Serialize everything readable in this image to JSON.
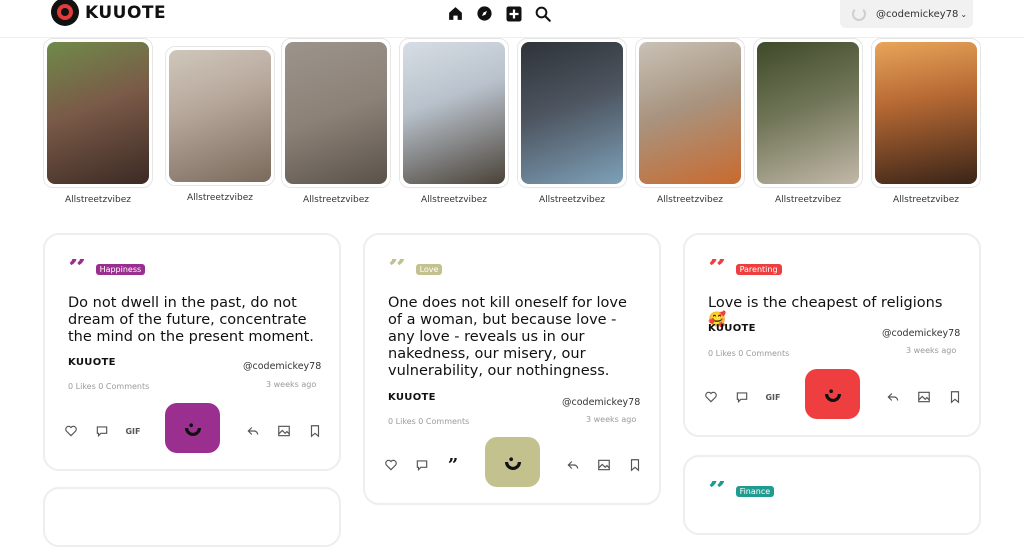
{
  "brand": {
    "name": "KUUOTE"
  },
  "header": {
    "nav": [
      "home-icon",
      "compass-icon",
      "add-icon",
      "search-icon"
    ],
    "user": {
      "handle": "@codemickey78"
    }
  },
  "stories": [
    {
      "author": "Allstreetzvibez",
      "color": "#7a5a48"
    },
    {
      "author": "Allstreetzvibez",
      "color": "#b8a89c"
    },
    {
      "author": "Allstreetzvibez",
      "color": "#8c8177"
    },
    {
      "author": "Allstreetzvibez",
      "color": "#b9c2cc"
    },
    {
      "author": "Allstreetzvibez",
      "color": "#4d5560"
    },
    {
      "author": "Allstreetzvibez",
      "color": "#a89480"
    },
    {
      "author": "Allstreetzvibez",
      "color": "#6f7456"
    },
    {
      "author": "Allstreetzvibez",
      "color": "#8a5a3a"
    }
  ],
  "cards": [
    {
      "tag": "Happiness",
      "color": "#9b2f8f",
      "quote": "Do not dwell in the past, do not dream of the future, concentrate the mind on the present moment.",
      "brand": "KUUOTE",
      "handle": "@codemickey78",
      "stats": "0 Likes 0 Comments",
      "ago": "3 weeks ago",
      "third_action": "GIF"
    },
    {
      "tag": "Love",
      "color": "#c3c28f",
      "quote": "One does not kill oneself for love of a woman, but because love - any love - reveals us in our nakedness, our misery, our vulnerability, our nothingness.",
      "brand": "KUUOTE",
      "handle": "@codemickey78",
      "stats": "0 Likes 0 Comments",
      "ago": "3 weeks ago",
      "third_action": "quote"
    },
    {
      "tag": "Parenting",
      "color": "#ef3e40",
      "quote": "Love is the cheapest of religions 🥰",
      "brand": "KUUOTE",
      "handle": "@codemickey78",
      "stats": "0 Likes 0 Comments",
      "ago": "3 weeks ago",
      "third_action": "GIF"
    },
    {
      "tag": "Finance",
      "color": "#1f9c8f"
    }
  ]
}
